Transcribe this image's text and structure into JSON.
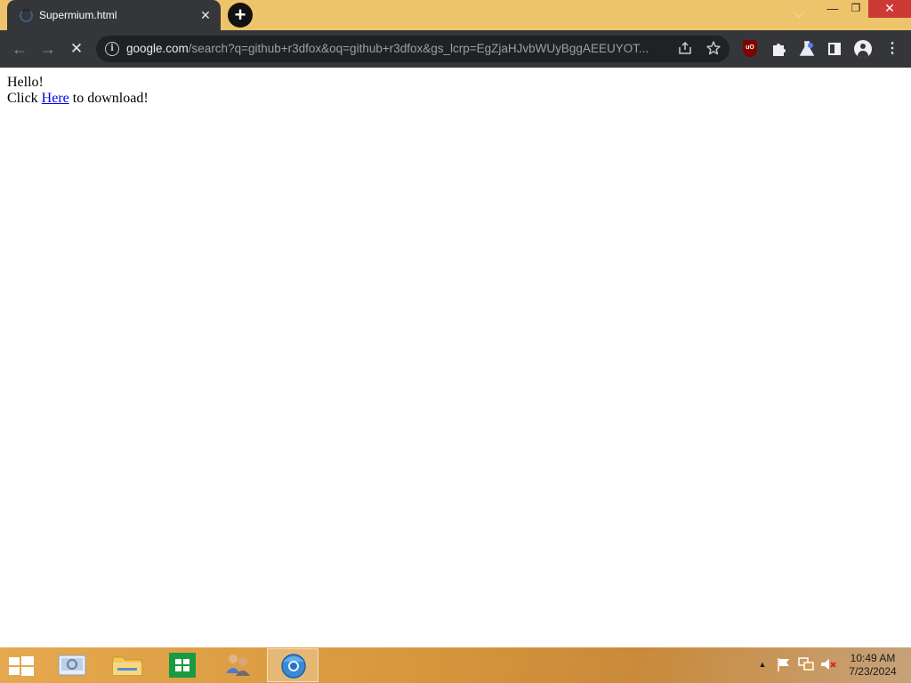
{
  "window": {
    "controls": {
      "minimize": "—",
      "maximize": "❐",
      "close": "✕"
    }
  },
  "tab": {
    "title": "Supermium.html",
    "close_glyph": "✕",
    "new_tab_glyph": "+"
  },
  "toolbar": {
    "back_glyph": "←",
    "forward_glyph": "→",
    "stop_glyph": "✕",
    "url_host": "google.com",
    "url_rest": "/search?q=github+r3dfox&oq=github+r3dfox&gs_lcrp=EgZjaHJvbWUyBggAEEUYOT...",
    "info_glyph": "i",
    "menu_glyph": "⋮",
    "ublock_label": "uO"
  },
  "page": {
    "line1": "Hello!",
    "line2_prefix": "Click ",
    "link_text": "Here",
    "line2_suffix": " to download!"
  },
  "taskbar": {
    "time": "10:49 AM",
    "date": "7/23/2024",
    "active_app": "browser"
  },
  "colors": {
    "titlebar": "#eec46a",
    "toolbar": "#35363a",
    "omnibox": "#202124",
    "close_button": "#cd3a36",
    "link": "#0000ee"
  }
}
